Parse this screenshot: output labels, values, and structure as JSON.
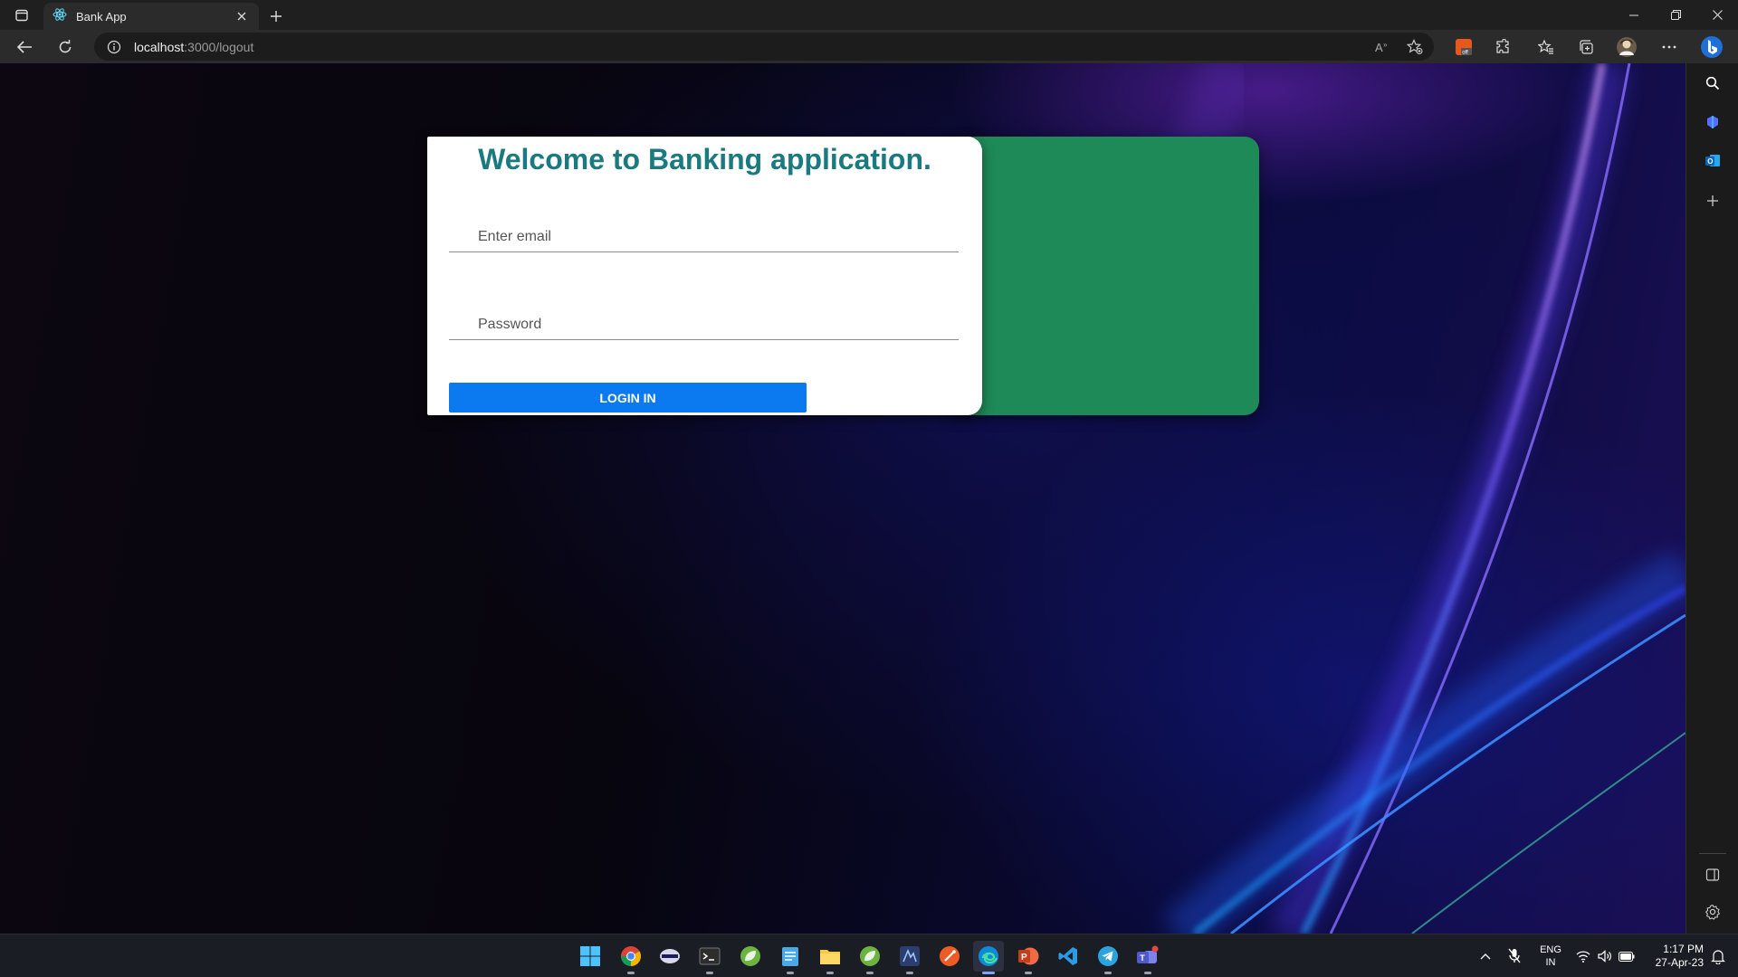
{
  "browser": {
    "tab_title": "Bank App",
    "url_host": "localhost",
    "url_path": ":3000/logout"
  },
  "login": {
    "heading": "Welcome to Banking application.",
    "email_placeholder": "Enter email",
    "password_placeholder": "Password",
    "submit_label": "LOGIN IN"
  },
  "colors": {
    "heading": "#1a7a7f",
    "green_panel": "#1e8a57",
    "login_button": "#0b7af0"
  },
  "taskbar": {
    "apps": [
      "start-menu",
      "chrome",
      "app-generic",
      "terminal",
      "spring-tools",
      "notepad",
      "file-explorer",
      "spring-tools-2",
      "eclipse",
      "postman",
      "edge",
      "powerpoint",
      "vscode",
      "telegram",
      "teams"
    ],
    "language_primary": "ENG",
    "language_secondary": "IN",
    "time": "1:17 PM",
    "date": "27-Apr-23"
  }
}
